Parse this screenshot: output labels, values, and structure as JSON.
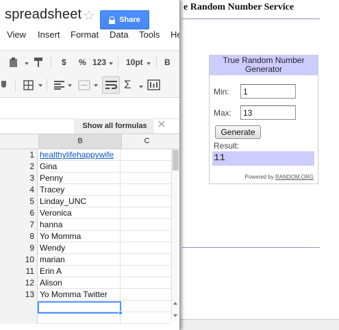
{
  "spreadsheet": {
    "title": "spreadsheet",
    "share_label": "Share",
    "menu": [
      "View",
      "Insert",
      "Format",
      "Data",
      "Tools",
      "He"
    ],
    "toolbar": {
      "currency": "$",
      "percent": "%",
      "number_format": "123",
      "font_size": "10pt",
      "bold": "B",
      "sum": "Σ"
    },
    "show_formulas": "Show all formulas",
    "columns": [
      "B",
      "C"
    ],
    "rows": [
      {
        "num": "1",
        "value": "healthylifehappywife"
      },
      {
        "num": "2",
        "value": "Gina"
      },
      {
        "num": "3",
        "value": "Penny"
      },
      {
        "num": "4",
        "value": "Tracey"
      },
      {
        "num": "5",
        "value": "Linday_UNC"
      },
      {
        "num": "6",
        "value": "Veronica"
      },
      {
        "num": "7",
        "value": "hanna"
      },
      {
        "num": "8",
        "value": "Yo Momma"
      },
      {
        "num": "9",
        "value": "Wendy"
      },
      {
        "num": "10",
        "value": "marian"
      },
      {
        "num": "11",
        "value": "Erin A"
      },
      {
        "num": "12",
        "value": "Alison"
      },
      {
        "num": "13",
        "value": "Yo Momma Twitter"
      },
      {
        "num": "",
        "value": ""
      },
      {
        "num": "",
        "value": ""
      }
    ]
  },
  "random_org": {
    "page_title": "e Random Number Service",
    "widget_title": "True Random Number Generator",
    "min_label": "Min:",
    "min_value": "1",
    "max_label": "Max:",
    "max_value": "13",
    "generate_label": "Generate",
    "result_label": "Result:",
    "result_value": "11",
    "powered_by": "Powered by",
    "powered_link": "RANDOM.ORG"
  },
  "colors": {
    "share_blue": "#4d90fe",
    "widget_lavender": "#ccccff",
    "link_blue": "#1155cc"
  }
}
